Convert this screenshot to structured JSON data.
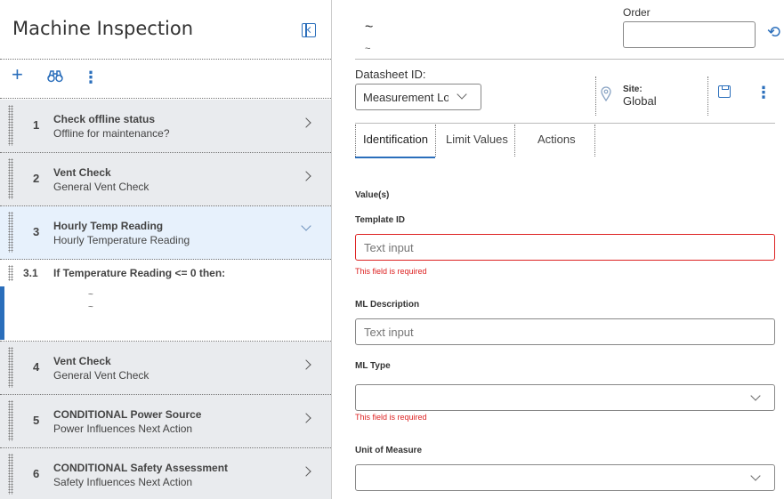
{
  "left_panel": {
    "title": "Machine Inspection",
    "toolbar": {
      "add_icon": "plus-icon",
      "search_icon": "binoculars-icon",
      "menu_icon": "kebab-icon"
    },
    "steps": [
      {
        "num": "1",
        "title": "Check offline status",
        "subtitle": "Offline for maintenance?"
      },
      {
        "num": "2",
        "title": "Vent Check",
        "subtitle": "General Vent Check"
      },
      {
        "num": "3",
        "title": "Hourly Temp Reading",
        "subtitle": "Hourly Temperature Reading"
      },
      {
        "num": "4",
        "title": "Vent Check",
        "subtitle": "General Vent Check"
      },
      {
        "num": "5",
        "title": "CONDITIONAL Power Source",
        "subtitle": "Power Influences Next Action"
      },
      {
        "num": "6",
        "title": "CONDITIONAL Safety Assessment",
        "subtitle": "Safety Influences Next Action"
      }
    ],
    "sub_condition": {
      "num": "3.1",
      "title": "If Temperature Reading <= 0 then:",
      "line1": "~",
      "line2": "~"
    }
  },
  "right_panel": {
    "header_title": "~",
    "header_subtitle": "~",
    "order_label": "Order",
    "order_value": "",
    "datasheet_label": "Datasheet ID:",
    "datasheet_value": "Measurement Location",
    "site_label": "Site:",
    "site_value": "Global",
    "tabs": [
      "Identification",
      "Limit Values",
      "Actions"
    ],
    "section_label": "Value(s)",
    "fields": {
      "template_id": {
        "label": "Template ID",
        "placeholder": "Text input",
        "error": "This field is required"
      },
      "ml_description": {
        "label": "ML Description",
        "placeholder": "Text input"
      },
      "ml_type": {
        "label": "ML Type",
        "value": "",
        "error": "This field is required"
      },
      "unit_of_measure": {
        "label": "Unit of Measure",
        "value": ""
      }
    }
  },
  "colors": {
    "accent": "#2a6ebb",
    "error": "#dd2222",
    "step_bg": "#e9ebee",
    "active_step_bg": "#e7f1fc"
  }
}
